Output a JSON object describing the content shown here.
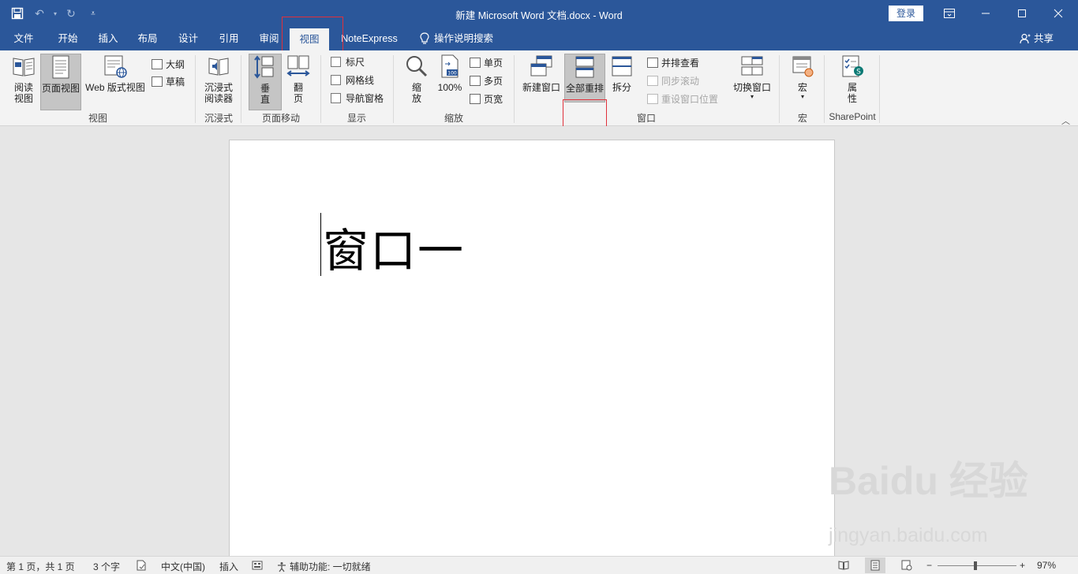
{
  "window": {
    "title": "新建 Microsoft Word 文档.docx  -  Word",
    "login_label": "登录",
    "controls": [
      "ribbon-options",
      "minimize",
      "maximize",
      "close"
    ]
  },
  "tabs": [
    {
      "label": "文件"
    },
    {
      "label": "开始"
    },
    {
      "label": "插入"
    },
    {
      "label": "布局"
    },
    {
      "label": "设计"
    },
    {
      "label": "引用"
    },
    {
      "label": "审阅"
    },
    {
      "label": "视图"
    },
    {
      "label": "NoteExpress"
    }
  ],
  "active_tab": "视图",
  "search_label": "操作说明搜索",
  "share_label": "共享",
  "ribbon": {
    "views": {
      "label": "视图",
      "read_mode": "阅读\n视图",
      "print_layout": "页面视图",
      "web_layout": "Web 版式视图",
      "outline": "大纲",
      "draft": "草稿"
    },
    "immersive": {
      "label": "沉浸式",
      "immersive_reader": "沉浸式\n阅读器"
    },
    "page_movement": {
      "label": "页面移动",
      "vertical": "垂\n直",
      "side_to_side": "翻\n页"
    },
    "show": {
      "label": "显示",
      "ruler": "标尺",
      "gridlines": "网格线",
      "nav_pane": "导航窗格"
    },
    "zoom": {
      "label": "缩放",
      "zoom": "缩\n放",
      "hundred": "100%",
      "one_page": "单页",
      "multiple_pages": "多页",
      "page_width": "页宽"
    },
    "window_group": {
      "label": "窗口",
      "new_window": "新建窗口",
      "arrange_all": "全部重排",
      "split": "拆分",
      "view_side_by_side": "并排查看",
      "sync_scroll": "同步滚动",
      "reset_position": "重设窗口位置",
      "switch_windows": "切换窗口"
    },
    "macros": {
      "label": "宏",
      "macros": "宏"
    },
    "sharepoint": {
      "label": "SharePoint",
      "properties": "属\n性"
    }
  },
  "document": {
    "text": "窗口一"
  },
  "statusbar": {
    "page": "第 1 页，共 1 页",
    "words": "3 个字",
    "language": "中文(中国)",
    "mode": "插入",
    "accessibility": "辅助功能: 一切就绪",
    "zoom_percent": "97%",
    "zoom_level": 0.97
  },
  "watermark": {
    "brand": "Baidu 经验",
    "url": "jingyan.baidu.com"
  },
  "colors": {
    "titlebar": "#2b579a",
    "ribbon": "#f3f3f3",
    "highlight": "#e0303a"
  }
}
